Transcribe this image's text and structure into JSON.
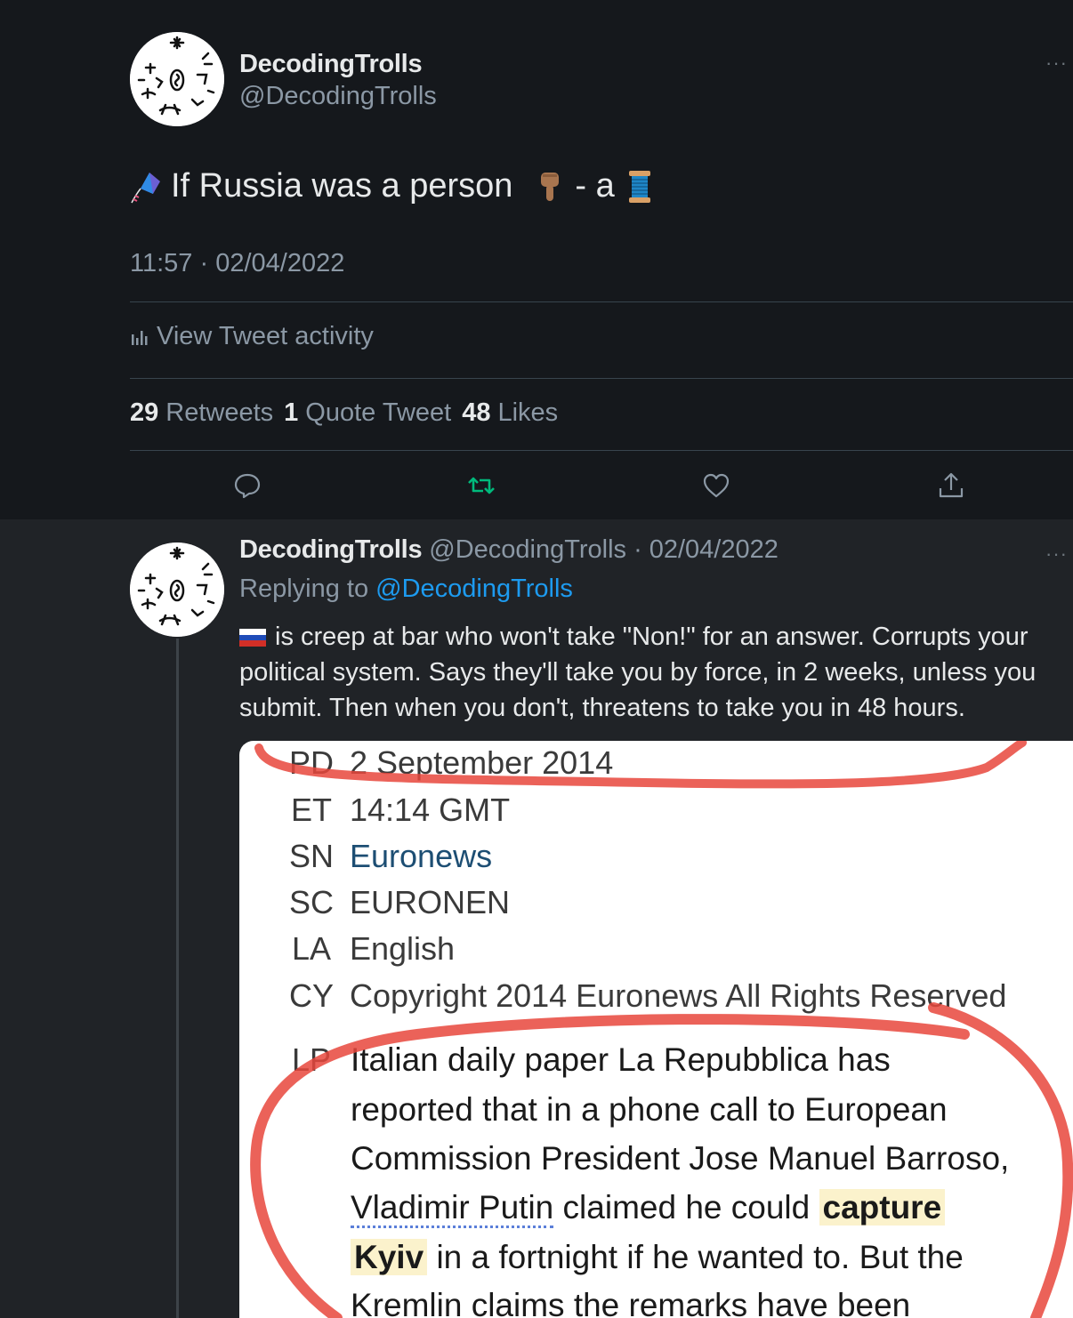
{
  "main_tweet": {
    "author_name": "DecodingTrolls",
    "author_handle": "@DecodingTrolls",
    "more_label": "···",
    "text_part1": "If Russia was a person",
    "text_part2": "- a",
    "emoji_icons": [
      "kite-icon",
      "pointing-down-icon",
      "thread-spool-icon"
    ],
    "timestamp": "11:57 · 02/04/2022",
    "activity_label": "View Tweet activity",
    "stats": {
      "retweets_count": "29",
      "retweets_label": "Retweets",
      "quotes_count": "1",
      "quotes_label": "Quote Tweet",
      "likes_count": "48",
      "likes_label": "Likes"
    },
    "actions": [
      "reply-icon",
      "retweet-icon",
      "like-icon",
      "share-icon"
    ]
  },
  "reply_tweet": {
    "author_name": "DecodingTrolls",
    "author_handle": "@DecodingTrolls",
    "separator": "·",
    "date": "02/04/2022",
    "more_label": "···",
    "replying_label": "Replying to",
    "replying_to": "@DecodingTrolls",
    "text": "is creep at bar who won't take \"Non!\" for an answer. Corrupts your political system. Says they'll take you by force, in 2 weeks, unless you submit. Then when you don't, threatens to take you in 48 hours."
  },
  "media_document": {
    "rows": [
      {
        "key": "PD",
        "value": "2 September 2014"
      },
      {
        "key": "ET",
        "value": "14:14 GMT"
      },
      {
        "key": "SN",
        "value": "Euronews"
      },
      {
        "key": "SC",
        "value": "EURONEN"
      },
      {
        "key": "LA",
        "value": "English"
      },
      {
        "key": "CY",
        "value": "Copyright 2014 Euronews All Rights Reserved"
      }
    ],
    "lp_key": "LP",
    "para_lines": [
      "Italian daily paper La Repubblica has",
      "reported that in a phone call to European",
      "Commission President Jose Manuel Barroso,"
    ],
    "line4_link": "Vladimir Putin",
    "line4_text": "claimed he could",
    "line4_highlight": "capture",
    "line5_highlight": "Kyiv",
    "line5_text": "in a fortnight if he wanted to. But the",
    "line6_text": "Kremlin claims the remarks have been"
  },
  "colors": {
    "background": "#15181c",
    "reply_background": "#202327",
    "accent": "#1d9bf0",
    "retweet_green": "#00ba7c",
    "annotation_red": "#e8463c"
  }
}
